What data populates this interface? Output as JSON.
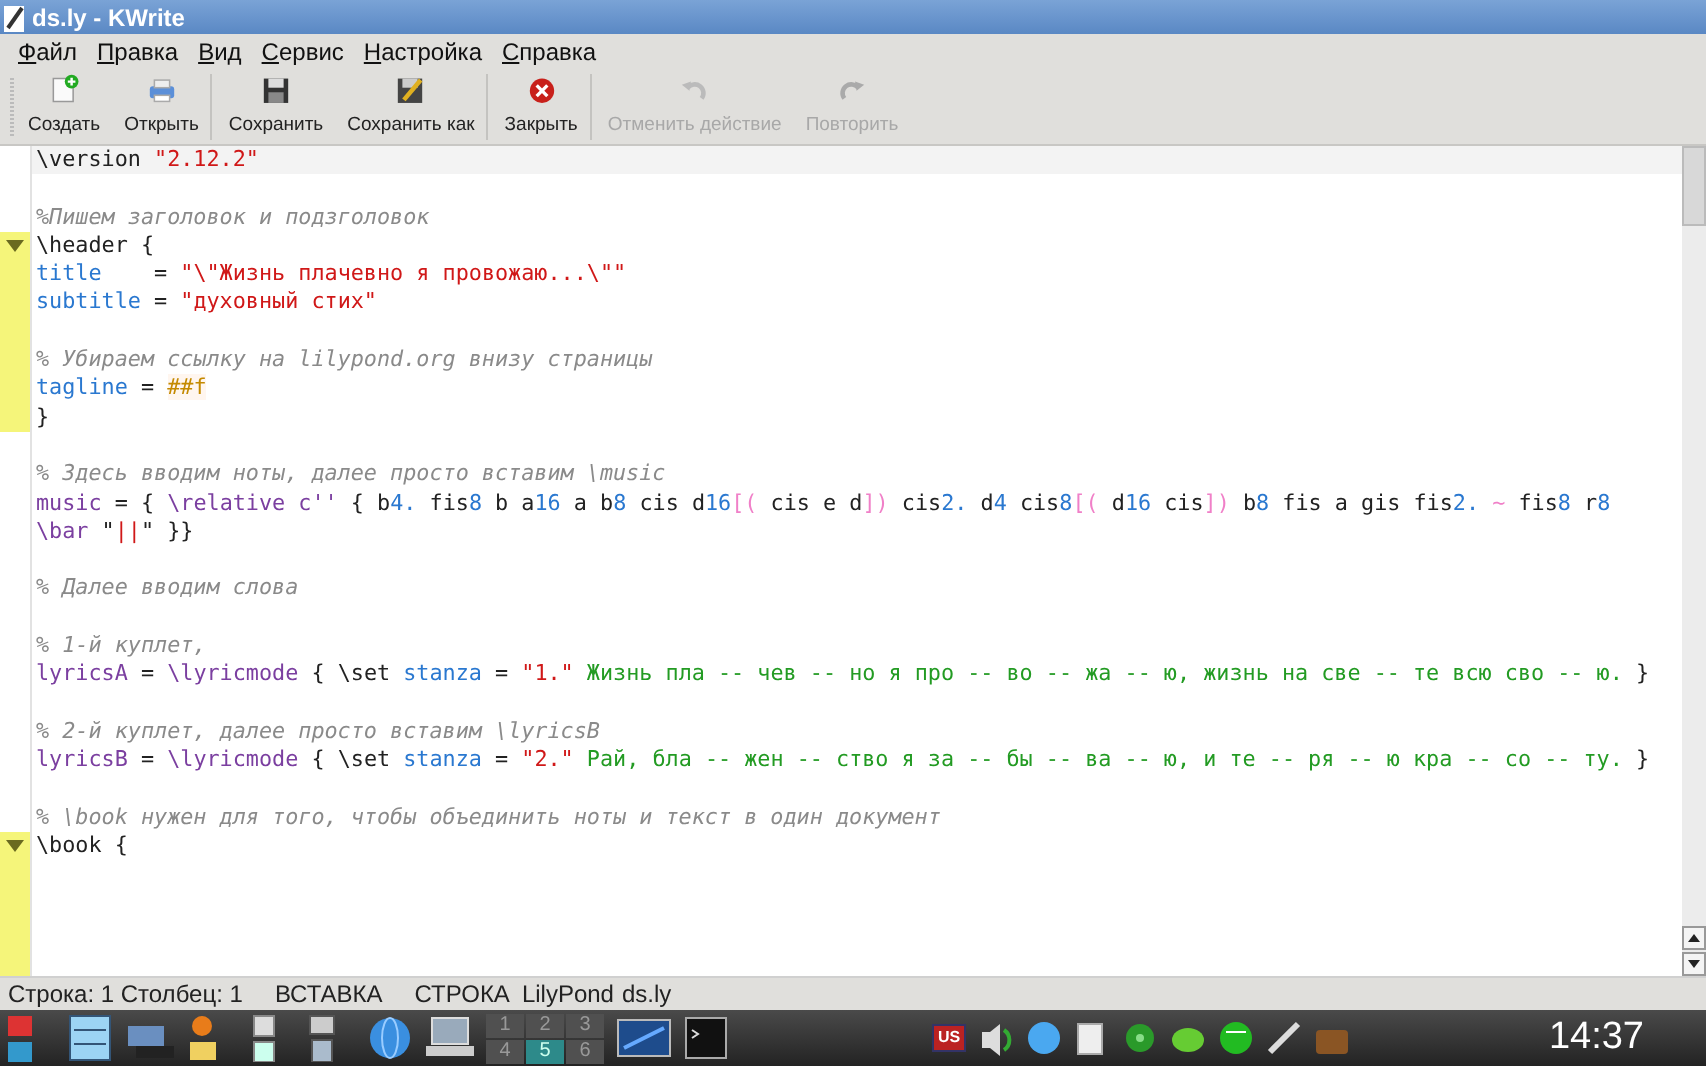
{
  "window": {
    "title": "ds.ly - KWrite"
  },
  "menu": [
    {
      "label": "Файл"
    },
    {
      "label": "Правка"
    },
    {
      "label": "Вид"
    },
    {
      "label": "Сервис"
    },
    {
      "label": "Настройка"
    },
    {
      "label": "Справка"
    }
  ],
  "toolbar": [
    {
      "label": "Создать",
      "kind": "new",
      "disabled": false,
      "separator_after": false
    },
    {
      "label": "Открыть",
      "kind": "open",
      "disabled": false,
      "separator_after": true
    },
    {
      "label": "Сохранить",
      "kind": "save",
      "disabled": false,
      "separator_after": false
    },
    {
      "label": "Сохранить как",
      "kind": "saveas",
      "disabled": false,
      "separator_after": true
    },
    {
      "label": "Закрыть",
      "kind": "close",
      "disabled": false,
      "separator_after": true
    },
    {
      "label": "Отменить действие",
      "kind": "undo",
      "disabled": true,
      "separator_after": false
    },
    {
      "label": "Повторить",
      "kind": "redo",
      "disabled": true,
      "separator_after": false
    }
  ],
  "editor": {
    "lines": [
      {
        "current": true,
        "fold_marker": false,
        "gutter_highlight": false,
        "tokens": [
          {
            "kind": "plain",
            "text": "\\version "
          },
          {
            "kind": "string",
            "text": "\"2.12.2\""
          }
        ]
      },
      {
        "current": false,
        "fold_marker": false,
        "gutter_highlight": false
      },
      {
        "current": false,
        "fold_marker": false,
        "gutter_highlight": false,
        "tokens": [
          {
            "kind": "comment",
            "text": "%Пишем заголовок и подзголовок"
          }
        ]
      },
      {
        "current": false,
        "fold_marker": true,
        "gutter_highlight": true,
        "tokens": [
          {
            "kind": "plain",
            "text": "\\header {"
          }
        ]
      },
      {
        "current": false,
        "fold_marker": false,
        "gutter_highlight": true,
        "tokens": [
          {
            "kind": "keyword",
            "text": "title"
          },
          {
            "kind": "plain",
            "text": "    = "
          },
          {
            "kind": "string",
            "text": "\"\\\"Жизнь плачевно я провожаю...\\\"\""
          }
        ]
      },
      {
        "current": false,
        "fold_marker": false,
        "gutter_highlight": true,
        "tokens": [
          {
            "kind": "keyword",
            "text": "subtitle"
          },
          {
            "kind": "plain",
            "text": " = "
          },
          {
            "kind": "string",
            "text": "\"духовный стих\""
          }
        ]
      },
      {
        "current": false,
        "fold_marker": false,
        "gutter_highlight": true
      },
      {
        "current": false,
        "fold_marker": false,
        "gutter_highlight": true,
        "tokens": [
          {
            "kind": "comment",
            "text": "% Убираем ссылку на lilypond.org внизу страницы"
          }
        ]
      },
      {
        "current": false,
        "fold_marker": false,
        "gutter_highlight": true,
        "tokens": [
          {
            "kind": "keyword",
            "text": "tagline"
          },
          {
            "kind": "plain",
            "text": " = "
          },
          {
            "kind": "scheme",
            "text": "##f"
          }
        ]
      },
      {
        "current": false,
        "fold_marker": false,
        "gutter_highlight": true,
        "tokens": [
          {
            "kind": "plain",
            "text": "}"
          }
        ]
      },
      {
        "current": false,
        "fold_marker": false,
        "gutter_highlight": false
      },
      {
        "current": false,
        "fold_marker": false,
        "gutter_highlight": false,
        "tokens": [
          {
            "kind": "comment",
            "text": "% Здесь вводим ноты, далее просто вставим \\music"
          }
        ]
      },
      {
        "current": false,
        "fold_marker": false,
        "gutter_highlight": false,
        "tokens": [
          {
            "kind": "variable",
            "text": "music"
          },
          {
            "kind": "plain",
            "text": " = { "
          },
          {
            "kind": "variable",
            "text": "\\relative c''"
          },
          {
            "kind": "plain",
            "text": " { b"
          },
          {
            "kind": "number",
            "text": "4."
          },
          {
            "kind": "plain",
            "text": " fis"
          },
          {
            "kind": "number",
            "text": "8"
          },
          {
            "kind": "plain",
            "text": " b a"
          },
          {
            "kind": "number",
            "text": "16"
          },
          {
            "kind": "plain",
            "text": " a b"
          },
          {
            "kind": "number",
            "text": "8"
          },
          {
            "kind": "plain",
            "text": " cis d"
          },
          {
            "kind": "number",
            "text": "16"
          },
          {
            "kind": "bracket",
            "text": "[("
          },
          {
            "kind": "plain",
            "text": " cis e d"
          },
          {
            "kind": "bracket",
            "text": "])"
          },
          {
            "kind": "plain",
            "text": " cis"
          },
          {
            "kind": "number",
            "text": "2."
          },
          {
            "kind": "plain",
            "text": " d"
          },
          {
            "kind": "number",
            "text": "4"
          },
          {
            "kind": "plain",
            "text": " cis"
          },
          {
            "kind": "number",
            "text": "8"
          },
          {
            "kind": "bracket",
            "text": "[("
          },
          {
            "kind": "plain",
            "text": " d"
          },
          {
            "kind": "number",
            "text": "16"
          },
          {
            "kind": "plain",
            "text": " cis"
          },
          {
            "kind": "bracket",
            "text": "])"
          },
          {
            "kind": "plain",
            "text": " b"
          },
          {
            "kind": "number",
            "text": "8"
          },
          {
            "kind": "plain",
            "text": " fis a gis fis"
          },
          {
            "kind": "number",
            "text": "2."
          },
          {
            "kind": "bracket",
            "text": " ~"
          },
          {
            "kind": "plain",
            "text": " fis"
          },
          {
            "kind": "number",
            "text": "8"
          },
          {
            "kind": "plain",
            "text": " r"
          },
          {
            "kind": "number",
            "text": "8"
          }
        ]
      },
      {
        "current": false,
        "fold_marker": false,
        "gutter_highlight": false,
        "tokens": [
          {
            "kind": "variable",
            "text": "\\bar"
          },
          {
            "kind": "plain",
            "text": " \""
          },
          {
            "kind": "string",
            "text": "||"
          },
          {
            "kind": "plain",
            "text": "\" }}"
          }
        ]
      },
      {
        "current": false,
        "fold_marker": false,
        "gutter_highlight": false
      },
      {
        "current": false,
        "fold_marker": false,
        "gutter_highlight": false,
        "tokens": [
          {
            "kind": "comment",
            "text": "% Далее вводим слова"
          }
        ]
      },
      {
        "current": false,
        "fold_marker": false,
        "gutter_highlight": false
      },
      {
        "current": false,
        "fold_marker": false,
        "gutter_highlight": false,
        "tokens": [
          {
            "kind": "comment",
            "text": "% 1-й куплет,"
          }
        ]
      },
      {
        "current": false,
        "fold_marker": false,
        "gutter_highlight": false,
        "tokens": [
          {
            "kind": "variable",
            "text": "lyricsA"
          },
          {
            "kind": "plain",
            "text": " = "
          },
          {
            "kind": "variable",
            "text": "\\lyricmode"
          },
          {
            "kind": "plain",
            "text": " { \\set "
          },
          {
            "kind": "keyword",
            "text": "stanza"
          },
          {
            "kind": "plain",
            "text": " = "
          },
          {
            "kind": "string",
            "text": "\"1.\""
          },
          {
            "kind": "lyric",
            "text": " Жизнь пла -- чев -- но я про -- во -- жа -- ю, жизнь на све -- те всю сво -- ю."
          },
          {
            "kind": "plain",
            "text": " }"
          }
        ]
      },
      {
        "current": false,
        "fold_marker": false,
        "gutter_highlight": false
      },
      {
        "current": false,
        "fold_marker": false,
        "gutter_highlight": false,
        "tokens": [
          {
            "kind": "comment",
            "text": "% 2-й куплет, далее просто вставим \\lyricsB"
          }
        ]
      },
      {
        "current": false,
        "fold_marker": false,
        "gutter_highlight": false,
        "tokens": [
          {
            "kind": "variable",
            "text": "lyricsB"
          },
          {
            "kind": "plain",
            "text": " = "
          },
          {
            "kind": "variable",
            "text": "\\lyricmode"
          },
          {
            "kind": "plain",
            "text": " { \\set "
          },
          {
            "kind": "keyword",
            "text": "stanza"
          },
          {
            "kind": "plain",
            "text": " = "
          },
          {
            "kind": "string",
            "text": "\"2.\""
          },
          {
            "kind": "lyric",
            "text": " Рай, бла -- жен -- ство я за -- бы -- ва -- ю, и те -- ря -- ю кра -- со -- ту."
          },
          {
            "kind": "plain",
            "text": " }"
          }
        ]
      },
      {
        "current": false,
        "fold_marker": false,
        "gutter_highlight": false
      },
      {
        "current": false,
        "fold_marker": false,
        "gutter_highlight": false,
        "tokens": [
          {
            "kind": "comment",
            "text": "% \\book нужен для того, чтобы объединить ноты и текст в один документ"
          }
        ]
      },
      {
        "current": false,
        "fold_marker": true,
        "gutter_highlight": true,
        "tokens": [
          {
            "kind": "plain",
            "text": "\\book {"
          }
        ]
      },
      {
        "current": false,
        "fold_marker": false,
        "gutter_highlight": true
      },
      {
        "current": false,
        "fold_marker": false,
        "gutter_highlight": true
      },
      {
        "current": false,
        "fold_marker": false,
        "gutter_highlight": true
      },
      {
        "current": false,
        "fold_marker": false,
        "gutter_highlight": true
      }
    ]
  },
  "status_bar": [
    {
      "text": "Строка: 1 Столбец: 1"
    },
    {
      "text": "ВСТАВКА"
    },
    {
      "text": "СТРОКА"
    },
    {
      "text": "LilyPond"
    },
    {
      "text": "ds.ly"
    }
  ],
  "taskbar": {
    "pager": [
      {
        "label": "1",
        "selected": false
      },
      {
        "label": "2",
        "selected": false
      },
      {
        "label": "3",
        "selected": false
      },
      {
        "label": "4",
        "selected": false
      },
      {
        "label": "5",
        "selected": true
      },
      {
        "label": "6",
        "selected": false
      }
    ],
    "keyboard_layout": "US",
    "clock": "14:37"
  }
}
